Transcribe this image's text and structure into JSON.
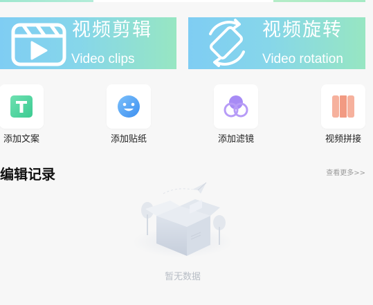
{
  "banners": [
    {
      "title": "视频剪辑",
      "subtitle": "Video clips",
      "icon": "clapperboard-play-icon"
    },
    {
      "title": "视频旋转",
      "subtitle": "Video rotation",
      "icon": "rotate-icon"
    }
  ],
  "tools": [
    {
      "label": "添加文案",
      "icon": "text-t-icon",
      "color": "#4fd6a0"
    },
    {
      "label": "添加贴纸",
      "icon": "smiley-sticker-icon",
      "color": "#5aa9f6"
    },
    {
      "label": "添加滤镜",
      "icon": "filter-circles-icon",
      "color": "#a78bf5"
    },
    {
      "label": "视频拼接",
      "icon": "columns-splice-icon",
      "color": "#f29a82"
    }
  ],
  "history": {
    "title": "编辑记录",
    "more_label": "查看更多>>",
    "empty_text": "暂无数据",
    "empty_icon": "empty-box-icon"
  },
  "colors": {
    "banner_gradient_start": "#7fcdf3",
    "banner_gradient_end": "#97e6c2",
    "background": "#f7f7f7"
  }
}
